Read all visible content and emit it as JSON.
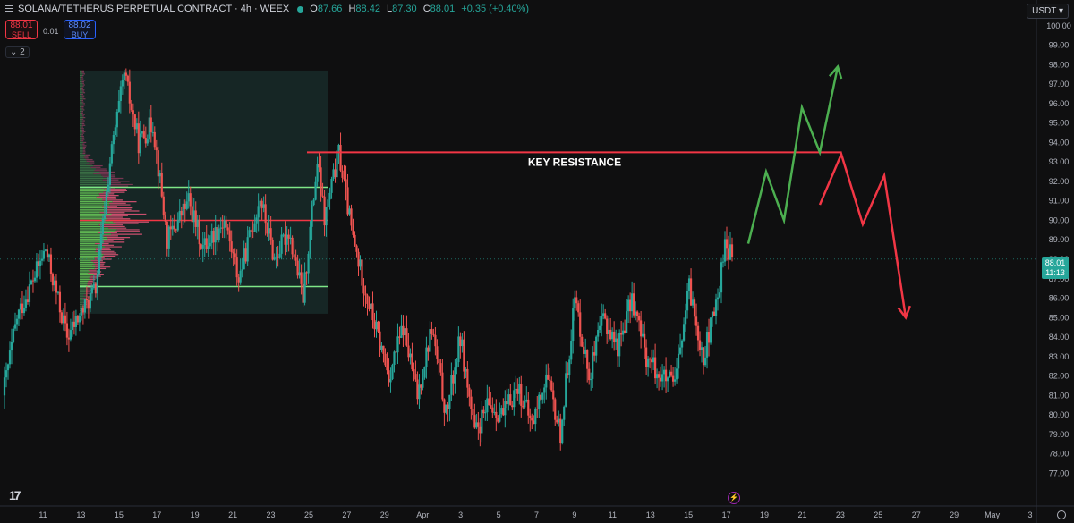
{
  "header": {
    "symbol": "SOLANA/TETHERUS PERPETUAL CONTRACT · 4h · WEEX",
    "o_label": "O",
    "o": "87.66",
    "h_label": "H",
    "h": "88.42",
    "l_label": "L",
    "l": "87.30",
    "c_label": "C",
    "c": "88.01",
    "change": "+0.35 (+0.40%)"
  },
  "trade": {
    "sell_price": "88.01",
    "sell_label": "SELL",
    "spread": "0.01",
    "buy_price": "88.02",
    "buy_label": "BUY"
  },
  "indicators_toggle": "2",
  "currency": "USDT",
  "current_price": {
    "value": "88.01",
    "countdown": "11:13"
  },
  "colors": {
    "up": "#26a69a",
    "down": "#ef5350",
    "bg": "#0f0f10",
    "resistance": "#f23645",
    "bullish": "#4caf50"
  },
  "icons": [
    "menu-icon",
    "tradingview-logo-icon",
    "flash-icon",
    "gear-icon"
  ],
  "chart_data": {
    "type": "candlestick",
    "title": "SOLANA/TETHERUS PERPETUAL CONTRACT · 4h · WEEX",
    "ylim": [
      75.5,
      100.5
    ],
    "y_ticks": [
      "77.00",
      "78.00",
      "79.00",
      "80.00",
      "81.00",
      "82.00",
      "83.00",
      "84.00",
      "85.00",
      "86.00",
      "87.00",
      "88.00",
      "89.00",
      "90.00",
      "91.00",
      "92.00",
      "93.00",
      "94.00",
      "95.00",
      "96.00",
      "97.00",
      "98.00",
      "99.00",
      "100.00"
    ],
    "x_ticks": [
      "11",
      "13",
      "15",
      "17",
      "19",
      "21",
      "23",
      "25",
      "27",
      "29",
      "Apr",
      "3",
      "5",
      "7",
      "9",
      "11",
      "13",
      "15",
      "17",
      "19",
      "21",
      "23",
      "25",
      "27",
      "29",
      "May",
      "3"
    ],
    "x_domain": [
      "Mar 11",
      "May 3"
    ],
    "price_path": [
      [
        0,
        81
      ],
      [
        2,
        85
      ],
      [
        6,
        88.5
      ],
      [
        9,
        84
      ],
      [
        13,
        86.5
      ],
      [
        15,
        93
      ],
      [
        17,
        97.5
      ],
      [
        19,
        94
      ],
      [
        21,
        95
      ],
      [
        23,
        89
      ],
      [
        26,
        91
      ],
      [
        28,
        88.6
      ],
      [
        31,
        90
      ],
      [
        33,
        87
      ],
      [
        36,
        91.2
      ],
      [
        38,
        88
      ],
      [
        40,
        89.5
      ],
      [
        42,
        86
      ],
      [
        44,
        93
      ],
      [
        45,
        90
      ],
      [
        47,
        93.5
      ],
      [
        49,
        89
      ],
      [
        51,
        86
      ],
      [
        54,
        82
      ],
      [
        56,
        84.5
      ],
      [
        58,
        81
      ],
      [
        60,
        84.5
      ],
      [
        62,
        80
      ],
      [
        64,
        84
      ],
      [
        66,
        79
      ],
      [
        68,
        80.5
      ],
      [
        70,
        80
      ],
      [
        72,
        81.5
      ],
      [
        74,
        79.5
      ],
      [
        76,
        82
      ],
      [
        78,
        79
      ],
      [
        80,
        86
      ],
      [
        82,
        82
      ],
      [
        84,
        85
      ],
      [
        86,
        83.5
      ],
      [
        88,
        86
      ],
      [
        90,
        83
      ],
      [
        92,
        82
      ],
      [
        94,
        81.5
      ],
      [
        96,
        86.5
      ],
      [
        98,
        83
      ],
      [
        100,
        86
      ],
      [
        101,
        89
      ],
      [
        102,
        88.01
      ]
    ],
    "price_path_note_units": "x = 4h candles from start of window",
    "volume_profile": {
      "range": [
        85.2,
        97.7
      ],
      "value_area_high": 91.7,
      "point_of_control": 90.0,
      "value_area_low": 86.6
    },
    "annotations": [
      {
        "type": "horizontal",
        "label": "KEY RESISTANCE",
        "price": 93.5,
        "from": "Mar 25",
        "to": "Apr 23"
      },
      {
        "type": "horizontal",
        "price": 88.01,
        "style": "dotted",
        "label": ""
      }
    ],
    "scenarios": [
      {
        "name": "",
        "color": "#4caf50",
        "path": [
          [
            0,
            88.8
          ],
          [
            1,
            92.5
          ],
          [
            2,
            90
          ],
          [
            3,
            95.8
          ],
          [
            4,
            93.5
          ],
          [
            5,
            97.9
          ]
        ],
        "arrow": "up"
      },
      {
        "name": "",
        "color": "#f23645",
        "path": [
          [
            0,
            90.8
          ],
          [
            1,
            93.4
          ],
          [
            2,
            89.8
          ],
          [
            3,
            92.3
          ],
          [
            4,
            85
          ]
        ],
        "arrow": "down"
      }
    ]
  }
}
